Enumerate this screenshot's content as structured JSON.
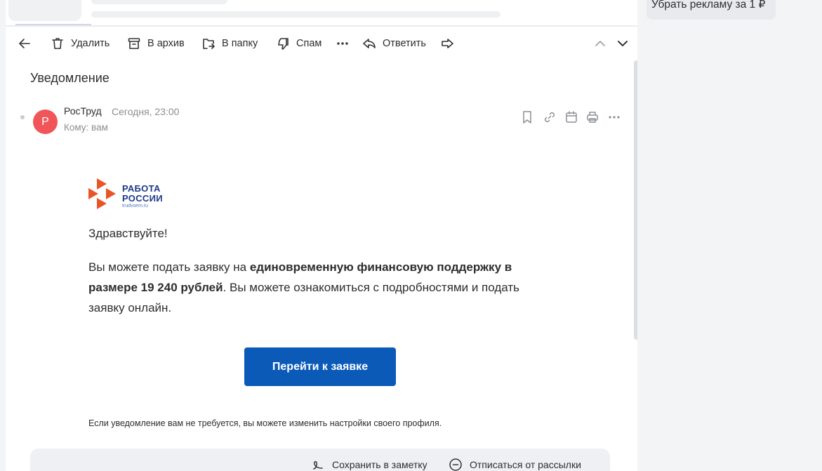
{
  "toolbar": {
    "delete_label": "Удалить",
    "archive_label": "В архив",
    "move_label": "В папку",
    "spam_label": "Спам",
    "reply_label": "Ответить"
  },
  "message": {
    "subject": "Уведомление",
    "avatar_letter": "Р",
    "avatar_color": "#f0555a",
    "sender": "РосТруд",
    "time": "Сегодня, 23:00",
    "to": "Кому: вам"
  },
  "body": {
    "logo_line1": "РАБОТА",
    "logo_line2": "РОССИИ",
    "logo_line3": "trudvsem.ru",
    "greeting": "Здравствуйте!",
    "text_part1": "Вы можете подать заявку на ",
    "text_bold": "единовременную финансовую поддержку в размере 19 240 рублей",
    "text_part2": ". Вы можете ознакомиться с подробностями и подать заявку онлайн.",
    "cta_label": "Перейти к заявке",
    "cta_color": "#0b5ab8",
    "footer_note": "Если уведомление вам не требуется, вы можете изменить настройки своего профиля."
  },
  "bottom_actions": {
    "save_note": "Сохранить в заметку",
    "unsubscribe": "Отписаться от рассылки"
  },
  "sidebar": {
    "ad_label": "Убрать рекламу за 1 ₽"
  }
}
